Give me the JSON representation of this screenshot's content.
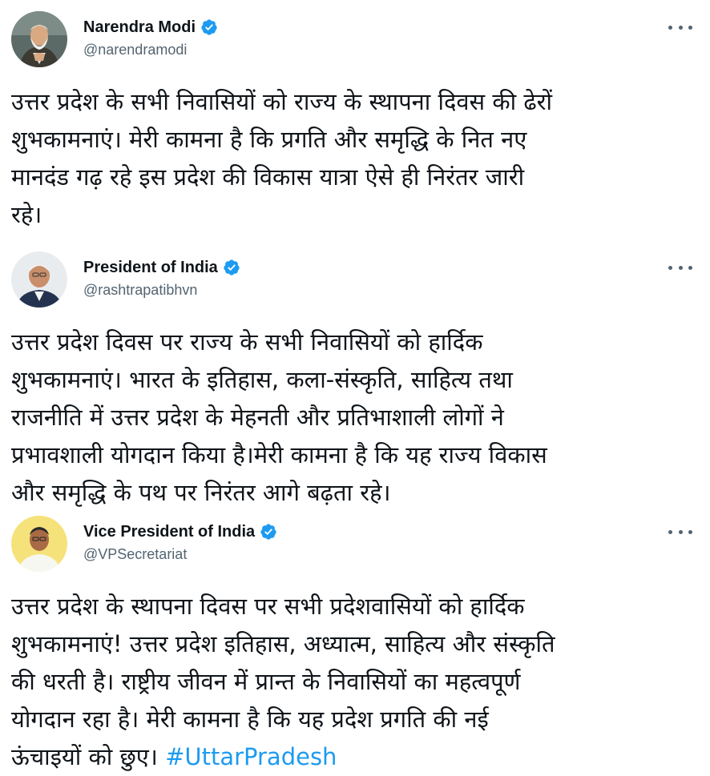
{
  "tweets": [
    {
      "author": {
        "name": "Narendra Modi",
        "handle": "@narendramodi",
        "verified": true,
        "avatar_bg": "#5b6a66"
      },
      "text": "उत्तर प्रदेश के सभी निवासियों को राज्य के स्थापना दिवस की ढेरों\nशुभकामनाएं। मेरी कामना है कि प्रगति और समृद्धि के नित नए\nमानदंड गढ़ रहे इस प्रदेश की विकास यात्रा ऐसे ही निरंतर जारी\nरहे।",
      "hashtag": ""
    },
    {
      "author": {
        "name": "President of India",
        "handle": "@rashtrapatibhvn",
        "verified": true,
        "avatar_bg": "#e9ecef"
      },
      "text": "उत्तर प्रदेश दिवस पर राज्य के सभी निवासियों को हार्दिक\nशुभकामनाएं। भारत के इतिहास, कला-संस्कृति, साहित्य तथा\nराजनीति में उत्तर प्रदेश के मेहनती और प्रतिभाशाली लोगों ने\nप्रभावशाली योगदान किया है।मेरी कामना है कि यह राज्य विकास\nऔर समृद्धि के पथ पर निरंतर आगे बढ़ता रहे।",
      "hashtag": ""
    },
    {
      "author": {
        "name": "Vice President of India",
        "handle": "@VPSecretariat",
        "verified": true,
        "avatar_bg": "#f6e27a"
      },
      "text": "उत्तर प्रदेश के स्थापना दिवस पर सभी प्रदेशवासियों को हार्दिक\nशुभकामनाएं! उत्तर प्रदेश इतिहास, अध्यात्म, साहित्य और संस्कृति\nकी धरती है। राष्ट्रीय जीवन में प्रान्त के निवासियों का महत्वपूर्ण\nयोगदान रहा है। मेरी कामना है कि यह प्रदेश प्रगति की नई\nऊंचाइयों को छुए। ",
      "hashtag": "#UttarPradesh"
    }
  ],
  "colors": {
    "text": "#0f1419",
    "secondary": "#536471",
    "link": "#1d9bf0",
    "verified": "#1d9bf0"
  },
  "icons": {
    "verified": "verified-badge-icon",
    "more": "more-options-icon"
  }
}
